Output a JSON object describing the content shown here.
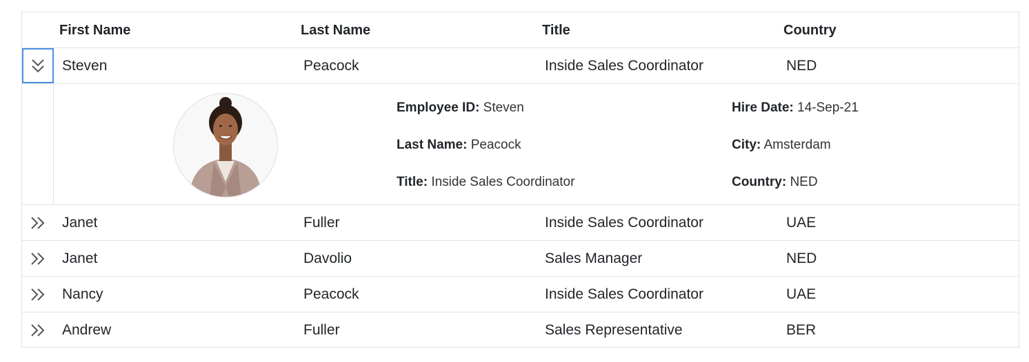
{
  "columns": [
    "First Name",
    "Last Name",
    "Title",
    "Country"
  ],
  "rows": [
    {
      "first": "Steven",
      "last": "Peacock",
      "title": "Inside Sales Coordinator",
      "country": "NED",
      "expanded": true
    },
    {
      "first": "Janet",
      "last": "Fuller",
      "title": "Inside Sales Coordinator",
      "country": "UAE",
      "expanded": false
    },
    {
      "first": "Janet",
      "last": "Davolio",
      "title": "Sales Manager",
      "country": "NED",
      "expanded": false
    },
    {
      "first": "Nancy",
      "last": "Peacock",
      "title": "Inside Sales Coordinator",
      "country": "UAE",
      "expanded": false
    },
    {
      "first": "Andrew",
      "last": "Fuller",
      "title": "Sales Representative",
      "country": "BER",
      "expanded": false
    }
  ],
  "detail": {
    "employee_id_label": "Employee ID:",
    "employee_id": "Steven",
    "last_name_label": "Last Name:",
    "last_name": "Peacock",
    "title_label": "Title:",
    "title": "Inside Sales Coordinator",
    "hire_date_label": "Hire Date:",
    "hire_date": "14-Sep-21",
    "city_label": "City:",
    "city": "Amsterdam",
    "country_label": "Country:",
    "country": "NED"
  },
  "icons": {
    "expanded": "chevron-double-down-icon",
    "collapsed": "chevron-double-right-icon"
  },
  "colors": {
    "focus_outline": "#4a90e2",
    "border": "#dee2e6",
    "icon": "#555555"
  }
}
